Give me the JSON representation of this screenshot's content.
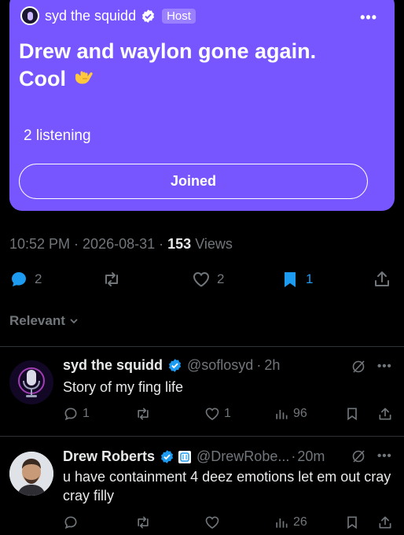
{
  "space": {
    "host_name": "syd the squidd",
    "host_badge": "Host",
    "title": "Drew and waylon gone again. Cool",
    "listening": "2 listening",
    "joined_label": "Joined",
    "accent_color": "#7856ff"
  },
  "meta": {
    "time": "10:52 PM",
    "date": "2026-08-31",
    "views_count": "153",
    "views_label": "Views"
  },
  "actions": {
    "replies": "2",
    "likes": "2",
    "bookmarks": "1"
  },
  "sort": {
    "label": "Relevant"
  },
  "replies": [
    {
      "name": "syd the squidd",
      "handle": "@soflosyd",
      "time": "2h",
      "text": "Story of my fing life",
      "reply_count": "1",
      "like_count": "1",
      "view_count": "96"
    },
    {
      "name": "Drew Roberts",
      "handle": "@DrewRobe...",
      "time": "20m",
      "text": "u have containment 4 deez emotions let em out cray cray filly",
      "view_count": "26"
    }
  ],
  "icons": {
    "verified": "verified-badge-icon",
    "reply": "reply-icon",
    "repost": "repost-icon",
    "like": "heart-icon",
    "bookmark": "bookmark-icon",
    "share": "share-icon",
    "views": "views-icon",
    "grok": "grok-icon",
    "more": "more-icon"
  },
  "colors": {
    "verified_blue": "#1d9bf0",
    "muted_text": "#71767b"
  }
}
